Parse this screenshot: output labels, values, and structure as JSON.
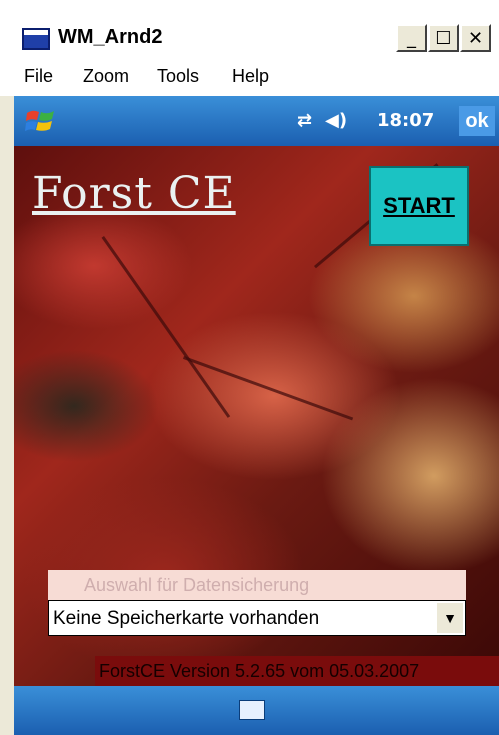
{
  "window": {
    "title": "WM_Arnd2",
    "controls": {
      "minimize": "_",
      "maximize": "☐",
      "close": "✕"
    }
  },
  "menu": {
    "items": [
      "File",
      "Zoom",
      "Tools",
      "Help"
    ]
  },
  "statusbar": {
    "start_icon": "windows-flag-icon",
    "connectivity_icon": "connectivity-arrows-icon",
    "speaker_icon": "speaker-icon",
    "time": "18:07",
    "ok_label": "ok"
  },
  "app": {
    "logo": "Forst CE",
    "start_button": "START",
    "backup_label": "Auswahl für Datensicherung",
    "storage_select": {
      "value": "Keine Speicherkarte vorhanden"
    },
    "version": "ForstCE Version 5.2.65 vom 05.03.2007"
  },
  "bottombar": {
    "keyboard_icon": "keyboard-icon"
  },
  "colors": {
    "start_button": "#1bc3c3",
    "taskbar": "#1b5fb0",
    "version_bg": "#7a0c0c"
  }
}
